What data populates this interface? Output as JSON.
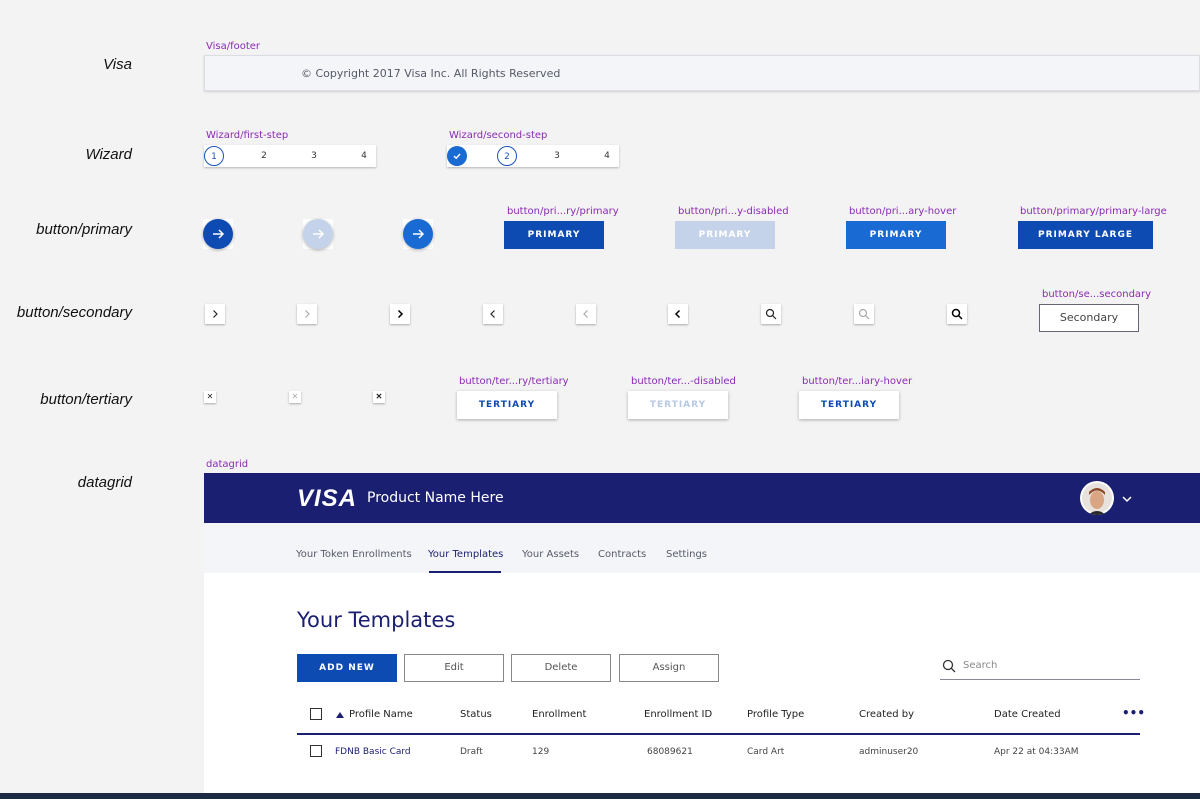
{
  "row_labels": {
    "visa": "Visa",
    "wizard": "Wizard",
    "button_primary": "button/primary",
    "button_secondary": "button/secondary",
    "button_tertiary": "button/tertiary",
    "datagrid": "datagrid"
  },
  "component_names": {
    "visa_footer": "Visa/footer",
    "wizard_first": "Wizard/first-step",
    "wizard_second": "Wizard/second-step",
    "primary": "button/pri...ry/primary",
    "primary_disabled": "button/pri...y-disabled",
    "primary_hover": "button/pri...ary-hover",
    "primary_large": "button/primary/primary-large",
    "secondary": "button/se...secondary",
    "tertiary": "button/ter...ry/tertiary",
    "tertiary_disabled": "button/ter...-disabled",
    "tertiary_hover": "button/ter...iary-hover",
    "datagrid": "datagrid"
  },
  "footer": {
    "copyright": "© Copyright 2017 Visa Inc. All Rights Reserved"
  },
  "wizard": {
    "first_steps": [
      "1",
      "2",
      "3",
      "4"
    ],
    "second_steps": [
      "2",
      "3",
      "4"
    ]
  },
  "buttons": {
    "primary": "PRIMARY",
    "primary_disabled": "PRIMARY",
    "primary_hover": "PRIMARY",
    "primary_large": "PRIMARY LARGE",
    "secondary": "Secondary",
    "tertiary": "TERTIARY",
    "tertiary_disabled": "TERTIARY",
    "tertiary_hover": "TERTIARY"
  },
  "grid": {
    "logo": "VISA",
    "product_name": "Product Name Here",
    "tabs": [
      "Your Token Enrollments",
      "Your Templates",
      "Your Assets",
      "Contracts",
      "Settings"
    ],
    "active_tab": "Your Templates",
    "page_title": "Your Templates",
    "actions": {
      "add_new": "ADD NEW",
      "edit": "Edit",
      "delete": "Delete",
      "assign": "Assign"
    },
    "search_placeholder": "Search",
    "columns": [
      "Profile Name",
      "Status",
      "Enrollment",
      "Enrollment ID",
      "Profile Type",
      "Created by",
      "Date Created"
    ],
    "more": "•••",
    "rows": [
      [
        "FDNB Basic Card",
        "Draft",
        "129",
        "68089621",
        "Card Art",
        "adminuser20",
        "Apr 22 at 04:33AM"
      ]
    ]
  },
  "colors": {
    "visa_blue": "#1a1f71",
    "primary": "#0d4bb3",
    "hover": "#1a6ad3",
    "disabled": "#c5d3ea",
    "label_purple": "#8b2ab3"
  }
}
